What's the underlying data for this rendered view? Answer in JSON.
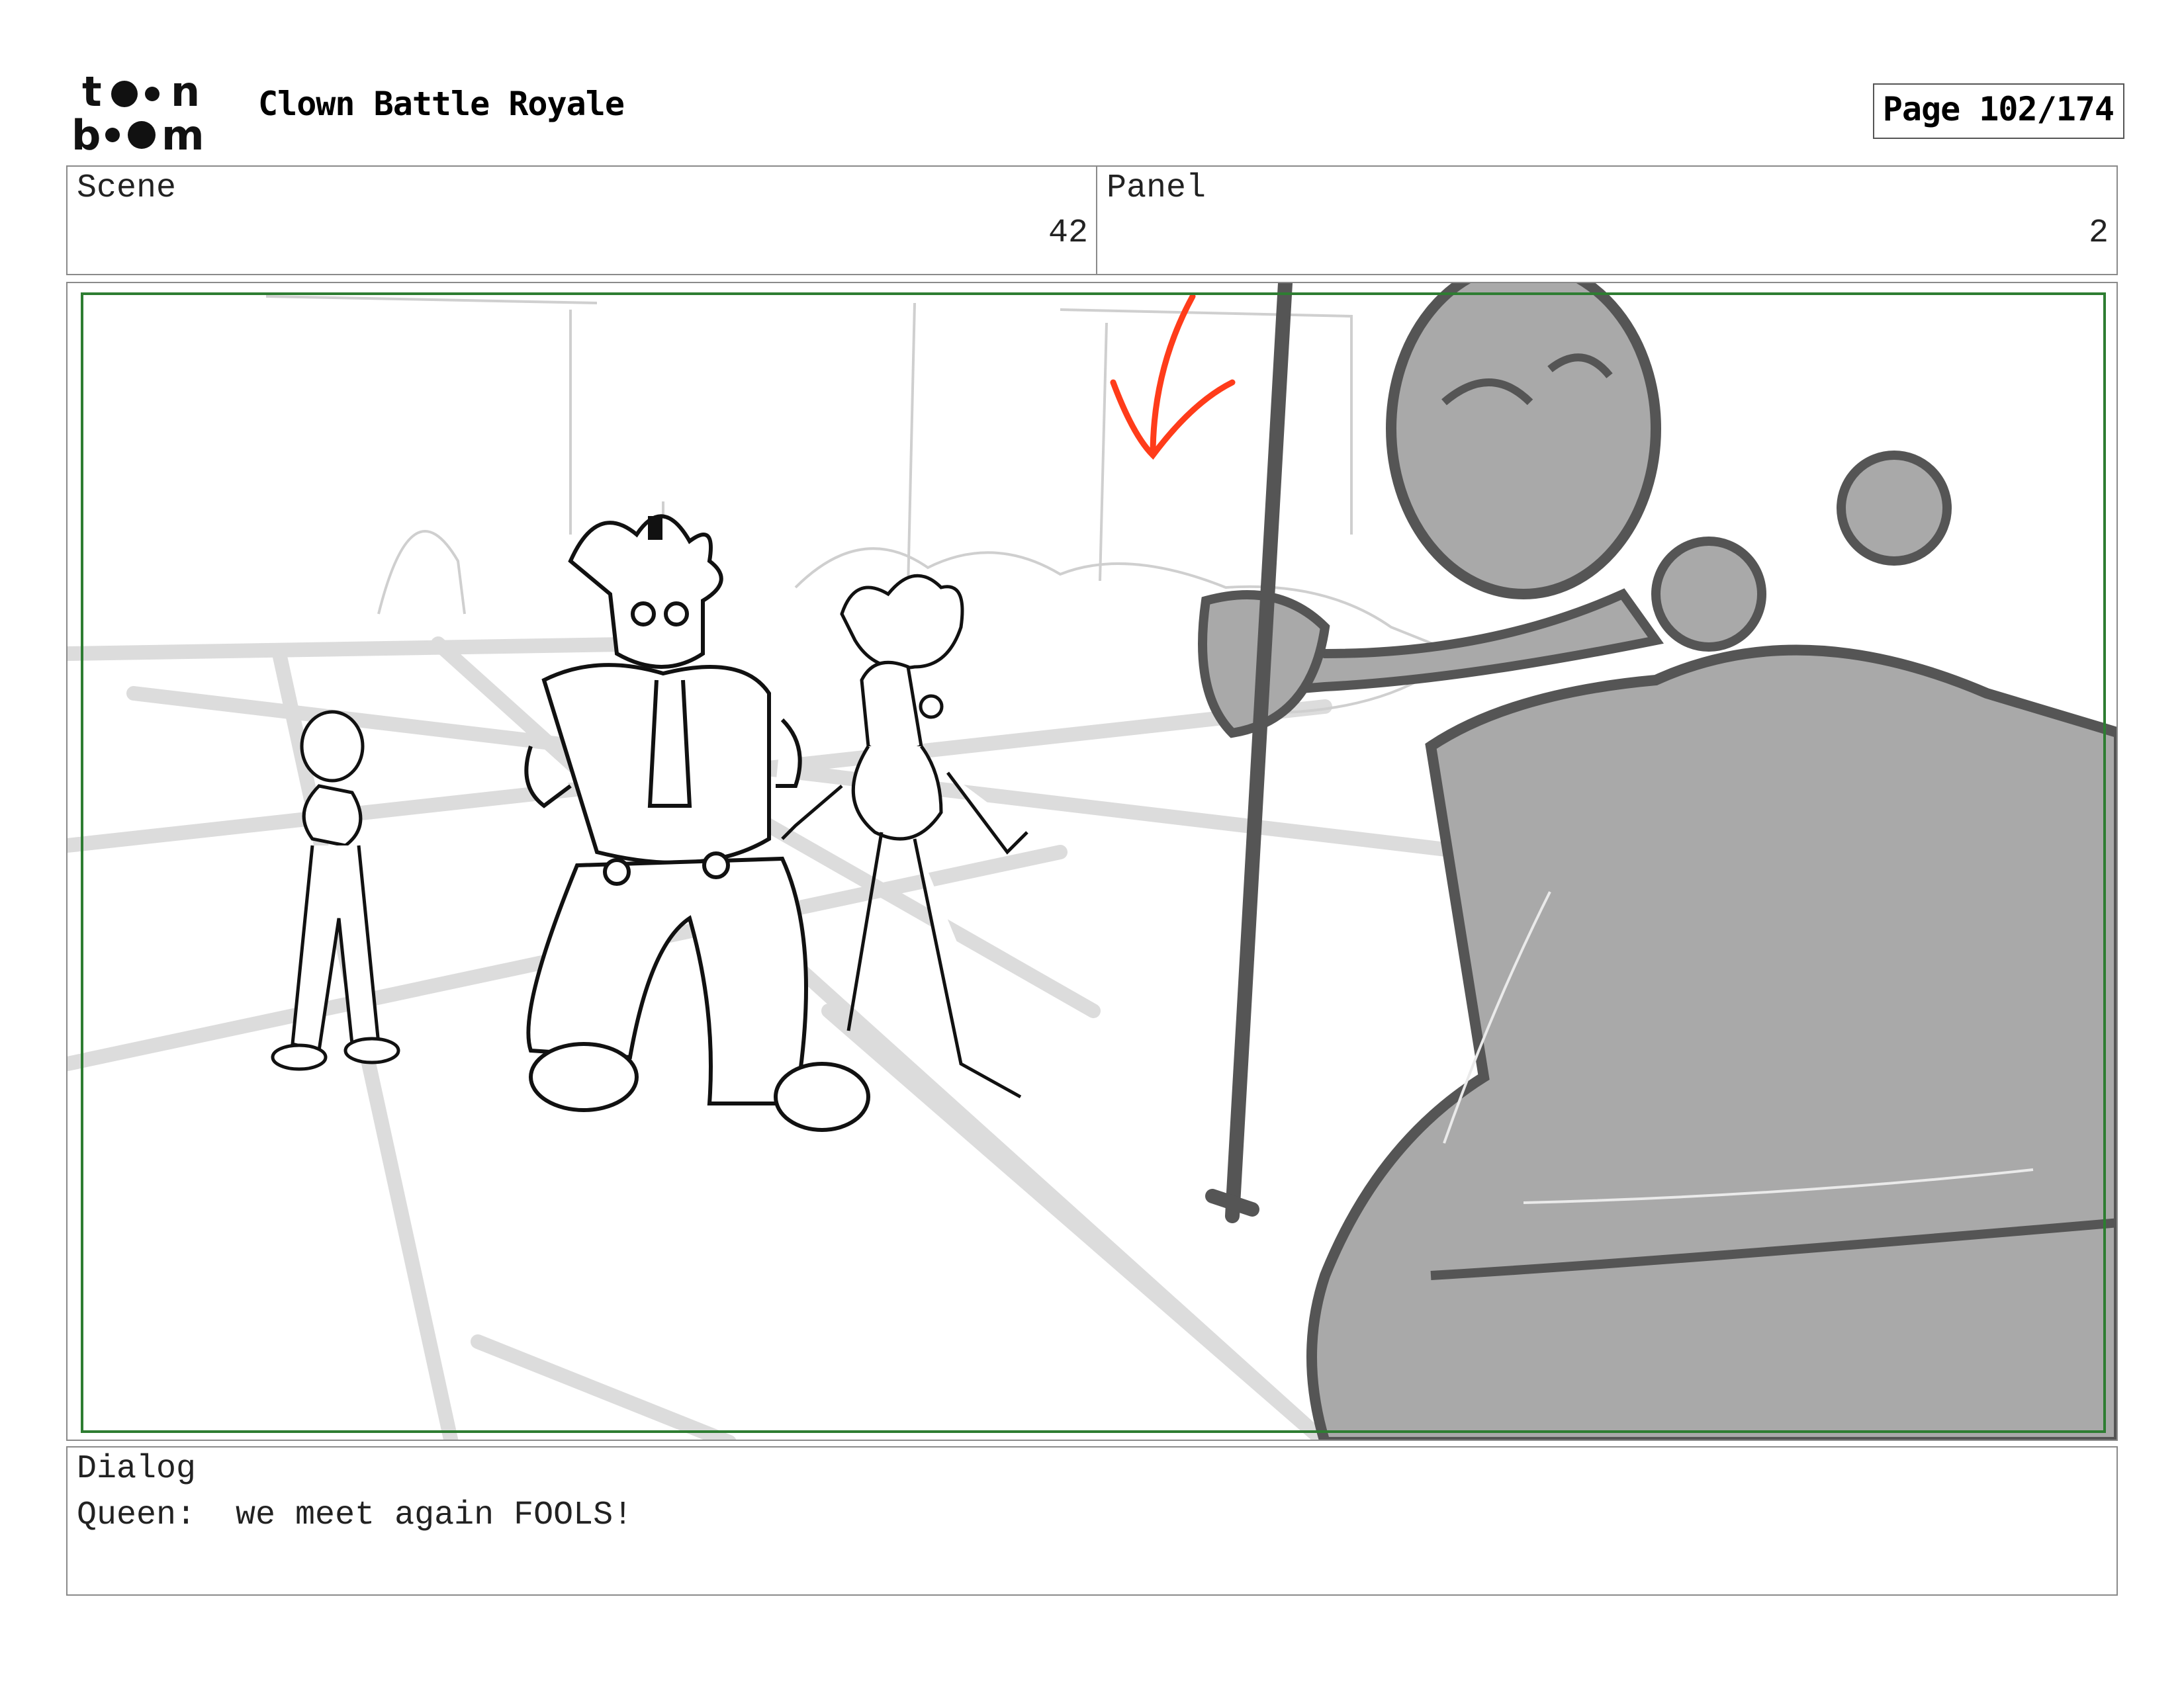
{
  "header": {
    "logo_text": "toon boom",
    "project_title": "Clown Battle Royale",
    "page_label": "Page 102/174"
  },
  "scene": {
    "label": "Scene",
    "value": "42"
  },
  "panel": {
    "label": "Panel",
    "value": "2"
  },
  "dialog": {
    "label": "Dialog",
    "line": "Queen:  we meet again FOOLS!"
  },
  "colors": {
    "safe_frame": "#2e7d32",
    "arrow": "#ff3c1a",
    "queen_fill": "#a9a9a9",
    "queen_line": "#555555",
    "guide_lines": "#d9d9d9"
  }
}
